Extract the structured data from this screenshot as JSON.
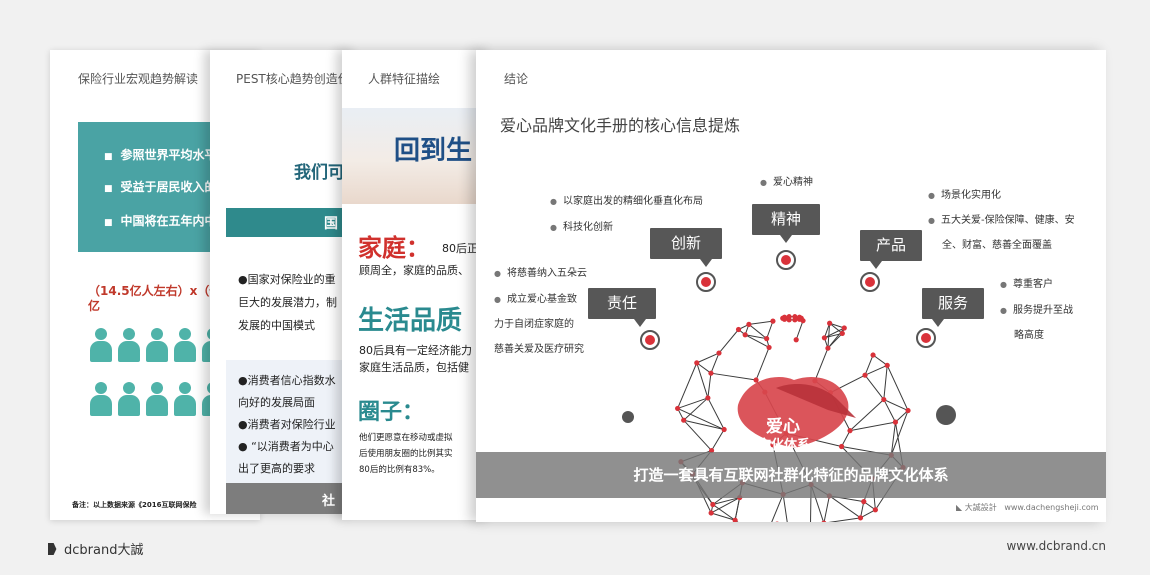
{
  "slides": {
    "s1": {
      "header": "保险行业宏观趋势解读",
      "bullets": [
        "参照世界平均水平",
        "受益于居民收入的",
        "中国将在五年内中"
      ],
      "formula_l1": "（14.5亿人左右）x（保",
      "formula_l2": "亿",
      "note": "备注：以上数据来源《2016互联网保险"
    },
    "s2": {
      "header": "PEST核心趋势创造价",
      "big": "我们可",
      "bar": "国",
      "p1": [
        "●国家对保险业的重",
        "巨大的发展潜力，制",
        "发展的中国模式"
      ],
      "p2": [
        "●消费者信心指数水",
        "向好的发展局面",
        "●消费者对保险行业",
        "●  “以消费者为中心",
        "出了更高的要求"
      ],
      "foot": "社"
    },
    "s3": {
      "header": "人群特征描绘",
      "hero": "回到生",
      "h1": "家庭：",
      "h1_tail": "80后正",
      "t1": [
        "顾周全，家庭的品质、"
      ],
      "h2": "生活品质",
      "t2": [
        "80后具有一定经济能力",
        "家庭生活品质，包括健"
      ],
      "h3": "圈子：",
      "t3": [
        "他们更愿意在移动或虚拟",
        "后使用朋友圈的比例其实",
        "80后的比例有83%。"
      ]
    },
    "s4": {
      "header": "结论",
      "title": "爱心品牌文化手册的核心信息提炼",
      "keywords": {
        "innovation": "创新",
        "spirit": "精神",
        "product": "产品",
        "responsibility": "责任",
        "service": "服务"
      },
      "spirit_bullets": [
        "爱心精神"
      ],
      "innovation_bullets": [
        "以家庭出发的精细化垂直化布局",
        "科技化创新"
      ],
      "product_bullets": [
        "场景化实用化",
        "五大关爱-保险保障、健康、安",
        "全、财富、慈善全面覆盖"
      ],
      "responsibility_bullets": [
        "将慈善纳入五朵云",
        "成立爱心基金致",
        "力于自闭症家庭的",
        "慈善关爱及医疗研究"
      ],
      "service_bullets": [
        "尊重客户",
        "服务提升至战",
        "略高度"
      ],
      "sphere_label_1": "爱心",
      "sphere_label_2": "文化体系",
      "banner": "打造一套具有互联网社群化特征的品牌文化体系",
      "footer_brand": "大誠設計",
      "footer_url": "www.dachengsheji.com"
    }
  },
  "page": {
    "logo": "dcbrand",
    "logo_cn": "大誠",
    "site": "www.dcbrand.cn"
  },
  "colors": {
    "teal": "#4aa3a4",
    "keyword_box": "#575757",
    "node_red": "#d9323a",
    "banner": "#787878"
  }
}
